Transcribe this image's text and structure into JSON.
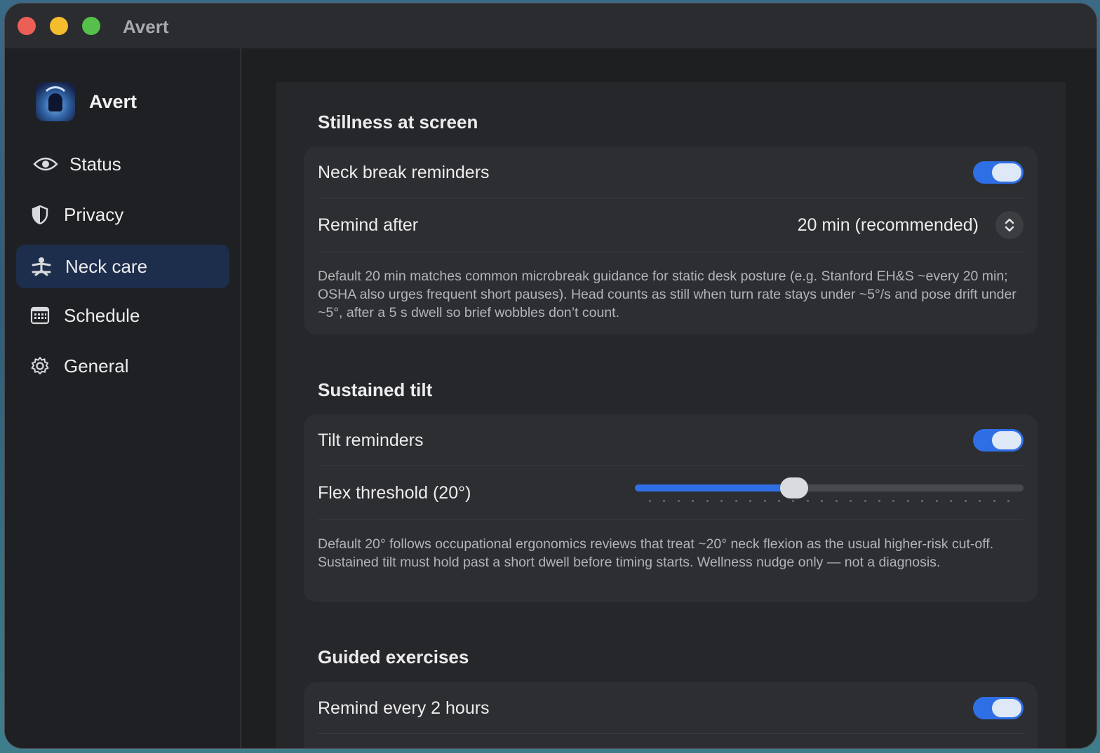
{
  "window": {
    "title": "Avert"
  },
  "sidebar": {
    "app_name": "Avert",
    "items": [
      {
        "label": "Status",
        "icon": "eye-icon"
      },
      {
        "label": "Privacy",
        "icon": "shield-icon"
      },
      {
        "label": "Neck care",
        "icon": "person-icon",
        "active": true
      },
      {
        "label": "Schedule",
        "icon": "calendar-icon"
      },
      {
        "label": "General",
        "icon": "gear-icon"
      }
    ]
  },
  "colors": {
    "accent": "#2f6fe6",
    "active_nav": "#1d2e4c"
  },
  "sections": {
    "stillness": {
      "title": "Stillness at screen",
      "toggle_label": "Neck break reminders",
      "toggle_on": true,
      "remind_label": "Remind after",
      "remind_value": "20 min (recommended)",
      "description": "Default 20 min matches common microbreak guidance for static desk posture (e.g. Stanford EH&S ~every 20 min; OSHA also urges frequent short pauses). Head counts as still when turn rate stays under ~5°/s and pose drift under ~5°, after a 5 s dwell so brief wobbles don’t count."
    },
    "tilt": {
      "title": "Sustained tilt",
      "toggle_label": "Tilt reminders",
      "toggle_on": true,
      "slider_label": "Flex threshold (20°)",
      "slider_fraction": 0.41,
      "description": "Default 20° follows occupational ergonomics reviews that treat ~20° neck flexion as the usual higher-risk cut-off. Sustained tilt must hold past a short dwell before timing starts. Wellness nudge only — not a diagnosis."
    },
    "exercises": {
      "title": "Guided exercises",
      "toggle_label": "Remind every 2 hours",
      "toggle_on": true
    }
  }
}
